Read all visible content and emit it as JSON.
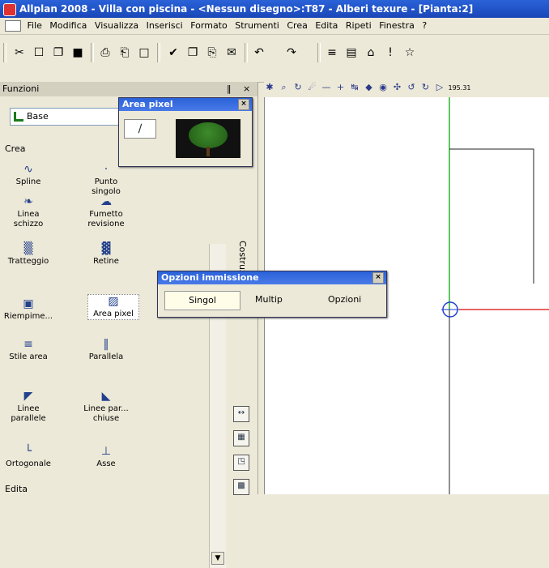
{
  "window": {
    "title": "Allplan 2008 - Villa con piscina - <Nessun disegno>:T87 - Alberi texure - [Pianta:2]"
  },
  "menu": [
    "File",
    "Modifica",
    "Visualizza",
    "Inserisci",
    "Formato",
    "Strumenti",
    "Crea",
    "Edita",
    "Ripeti",
    "Finestra",
    "?"
  ],
  "funzioni": {
    "title": "Funzioni",
    "pin": "‖",
    "close": "×",
    "combo": "Base",
    "crea": "Crea",
    "edita": "Edita",
    "tools": [
      {
        "label": "Spline",
        "icon": "∿"
      },
      {
        "label": "Punto singolo",
        "icon": "·"
      },
      {
        "label": "Linea schizzo",
        "icon": "❧"
      },
      {
        "label": "Fumetto revisione",
        "icon": "☁"
      },
      {
        "label": "Tratteggio",
        "icon": "▒"
      },
      {
        "label": "Retine",
        "icon": "▓"
      },
      {
        "label": "Riempime...",
        "icon": "▣"
      },
      {
        "label": "Area pixel",
        "icon": "▨"
      },
      {
        "label": "Stile area",
        "icon": "≡"
      },
      {
        "label": "Parallela",
        "icon": "‖"
      },
      {
        "label": "Linee parallele",
        "icon": "◤"
      },
      {
        "label": "Linee par... chiuse",
        "icon": "◣"
      },
      {
        "label": "Ortogonale",
        "icon": "└"
      },
      {
        "label": "Asse",
        "icon": "⊥"
      }
    ],
    "side_label": "Costruz"
  },
  "area_pixel": {
    "title": "Area pixel",
    "close": "×",
    "pipette": "∕"
  },
  "opzioni": {
    "title": "Opzioni immissione",
    "close": "×",
    "singol": "Singol",
    "multip": "Multip",
    "opzioni": "Opzioni"
  },
  "toolbar": {
    "icons": [
      "✂",
      "☐",
      "❐",
      "■",
      "⎙",
      "⎗",
      "□",
      "✔",
      "❐",
      "⎘",
      "✉",
      "↶",
      "↷",
      "≡",
      "▤",
      "⌂",
      "!",
      "☆"
    ]
  },
  "canvasbar": {
    "icons": [
      "✱",
      "⌕",
      "↻",
      "☄",
      "—",
      "+",
      "↹",
      "◆",
      "◉",
      "✣",
      "↺",
      "↻",
      "▷"
    ],
    "value": "195.31"
  },
  "colors": {
    "title_blue": "#1a47b8",
    "x_axis": "#e03030",
    "y_axis": "#28b428",
    "snap": "#2040d0"
  }
}
